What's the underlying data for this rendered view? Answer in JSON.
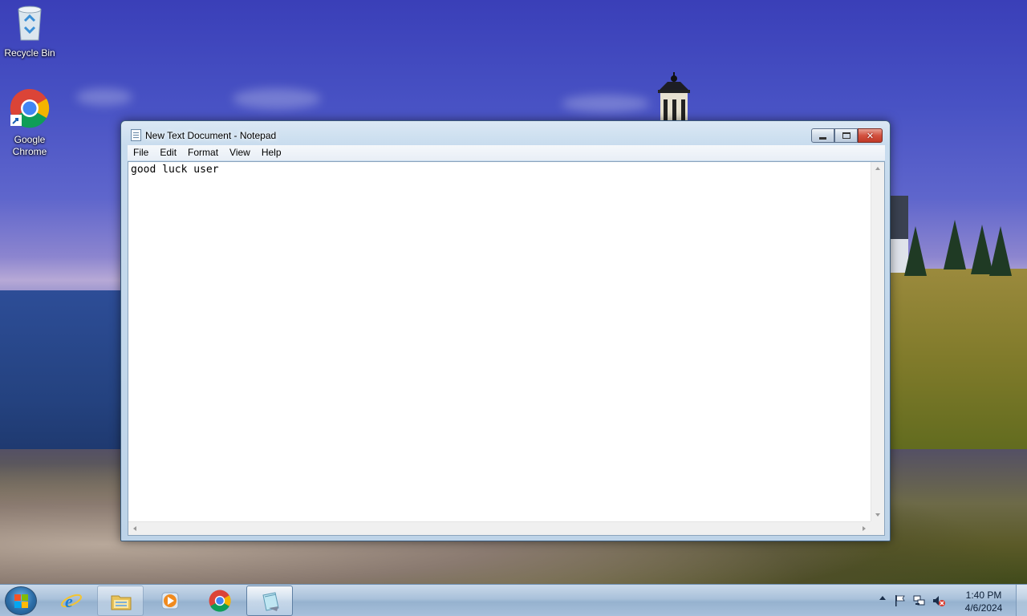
{
  "desktop": {
    "icons": [
      {
        "label": "Recycle Bin",
        "icon": "recycle-bin-icon"
      },
      {
        "label": "Google Chrome",
        "icon": "chrome-icon"
      }
    ]
  },
  "window": {
    "title": "New Text Document - Notepad",
    "icon": "notepad-icon",
    "controls": {
      "minimize": "minimize-icon",
      "maximize": "maximize-icon",
      "close": "close-icon"
    },
    "menu": [
      "File",
      "Edit",
      "Format",
      "View",
      "Help"
    ],
    "content": "good luck user"
  },
  "taskbar": {
    "start_icon": "windows-start-icon",
    "items": [
      {
        "name": "internet-explorer",
        "icon": "internet-explorer-icon",
        "state": "pinned"
      },
      {
        "name": "windows-explorer",
        "icon": "folder-icon",
        "state": "open"
      },
      {
        "name": "media-player",
        "icon": "media-player-icon",
        "state": "pinned"
      },
      {
        "name": "google-chrome",
        "icon": "chrome-icon",
        "state": "pinned"
      },
      {
        "name": "notepad",
        "icon": "notepad-icon",
        "state": "active"
      }
    ],
    "tray": {
      "icons": [
        "show-hidden-icons-icon",
        "action-center-flag-icon",
        "network-icon",
        "volume-muted-icon"
      ],
      "time": "1:40 PM",
      "date": "4/6/2024"
    }
  },
  "colors": {
    "taskbar": "#a9c1da",
    "window_frame": "#bdd3e8",
    "close_button": "#c03a28"
  }
}
